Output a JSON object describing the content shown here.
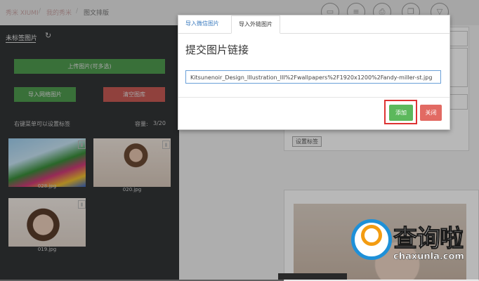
{
  "breadcrumb": {
    "site": "秀米 XIUMI",
    "sep1": "/",
    "my_xiumi": "我的秀米",
    "sep2": "/",
    "current": "图文排版"
  },
  "sidebar": {
    "tag_tab": "未标签图片",
    "upload_button": "上传图片(可多选)",
    "import_button": "导入网络图片",
    "clear_button": "清空图库",
    "hint": "右键菜单可以设置标签",
    "capacity_label": "容量:",
    "capacity_value": "3/20",
    "images": [
      {
        "name": "028.jpg"
      },
      {
        "name": "020.jpg"
      },
      {
        "name": "019.jpg"
      }
    ]
  },
  "editor": {
    "set_tag_button": "设置标签"
  },
  "modal": {
    "tabs": [
      "导入微信图片",
      "导入外链图片"
    ],
    "active_tab": "导入外链图片",
    "title": "提交图片链接",
    "url_value": "Kitsunenoir_Design_Illustration_III%2Fwallpapers%2F1920x1200%2Fandy-miller-st.jpg",
    "add_button": "添加",
    "close_button": "关闭"
  },
  "watermark": {
    "brand": "查询啦",
    "domain": "chaxunla.com"
  },
  "colors": {
    "accent_blue": "#3b7bbf",
    "success_green": "#5cb85c",
    "danger_red": "#e26a63",
    "highlight_red": "#dd3333"
  }
}
